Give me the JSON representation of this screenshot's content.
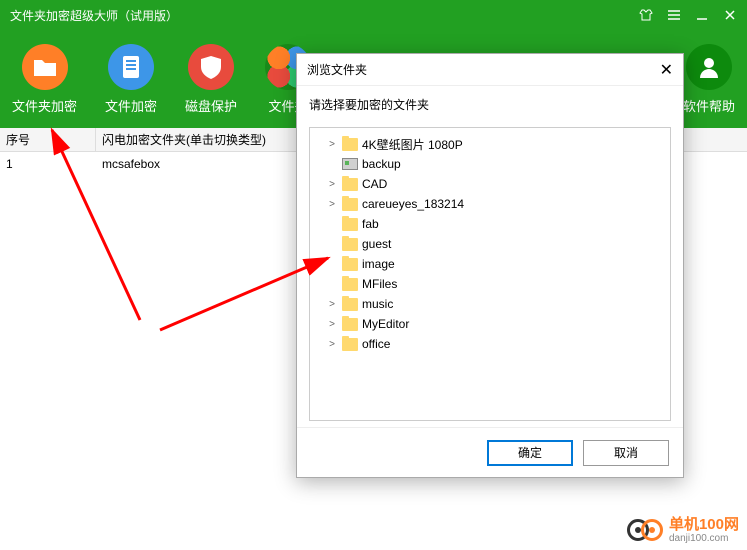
{
  "titlebar": {
    "title": "文件夹加密超级大师（试用版）"
  },
  "toolbar": {
    "folder_encrypt": "文件夹加密",
    "file_encrypt": "文件加密",
    "disk_protect": "磁盘保护",
    "folder_partial": "文件夹",
    "help": "软件帮助"
  },
  "table": {
    "col_seq": "序号",
    "col_name": "闪电加密文件夹(单击切换类型)",
    "rows": [
      {
        "seq": "1",
        "name": "mcsafebox"
      }
    ]
  },
  "dialog": {
    "title": "浏览文件夹",
    "hint": "请选择要加密的文件夹",
    "ok": "确定",
    "cancel": "取消",
    "items": [
      {
        "expand": ">",
        "icon": "folder",
        "label": "4K壁纸图片 1080P"
      },
      {
        "expand": "",
        "icon": "disk",
        "label": "backup"
      },
      {
        "expand": ">",
        "icon": "folder",
        "label": "CAD"
      },
      {
        "expand": ">",
        "icon": "folder",
        "label": "careueyes_183214"
      },
      {
        "expand": "",
        "icon": "folder",
        "label": "fab"
      },
      {
        "expand": "",
        "icon": "folder",
        "label": "guest"
      },
      {
        "expand": "",
        "icon": "folder",
        "label": "image"
      },
      {
        "expand": "",
        "icon": "folder",
        "label": "MFiles"
      },
      {
        "expand": ">",
        "icon": "folder",
        "label": "music"
      },
      {
        "expand": ">",
        "icon": "folder",
        "label": "MyEditor"
      },
      {
        "expand": ">",
        "icon": "folder",
        "label": "office"
      }
    ]
  },
  "watermark": {
    "cn": "单机100网",
    "en": "danji100.com"
  }
}
